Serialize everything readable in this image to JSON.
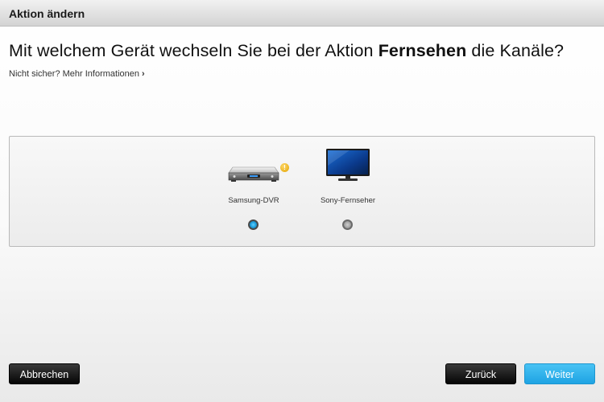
{
  "window": {
    "title": "Aktion ändern"
  },
  "question": {
    "prefix": "Mit welchem Gerät wechseln Sie bei der Aktion ",
    "activity": "Fernsehen",
    "suffix": " die Kanäle?"
  },
  "more_info": {
    "label": "Nicht sicher? Mehr Informationen",
    "chevron": "›"
  },
  "devices": [
    {
      "name": "Samsung-DVR",
      "icon": "dvr-icon",
      "selected": true,
      "warning": true,
      "warning_icon": "warning-icon"
    },
    {
      "name": "Sony-Fernseher",
      "icon": "tv-icon",
      "selected": false,
      "warning": false
    }
  ],
  "buttons": {
    "cancel": "Abbrechen",
    "back": "Zurück",
    "next": "Weiter"
  },
  "colors": {
    "primary_button": "#1ea3e3",
    "dark_button": "#050505",
    "radio_selected": "#1c9ddc"
  }
}
